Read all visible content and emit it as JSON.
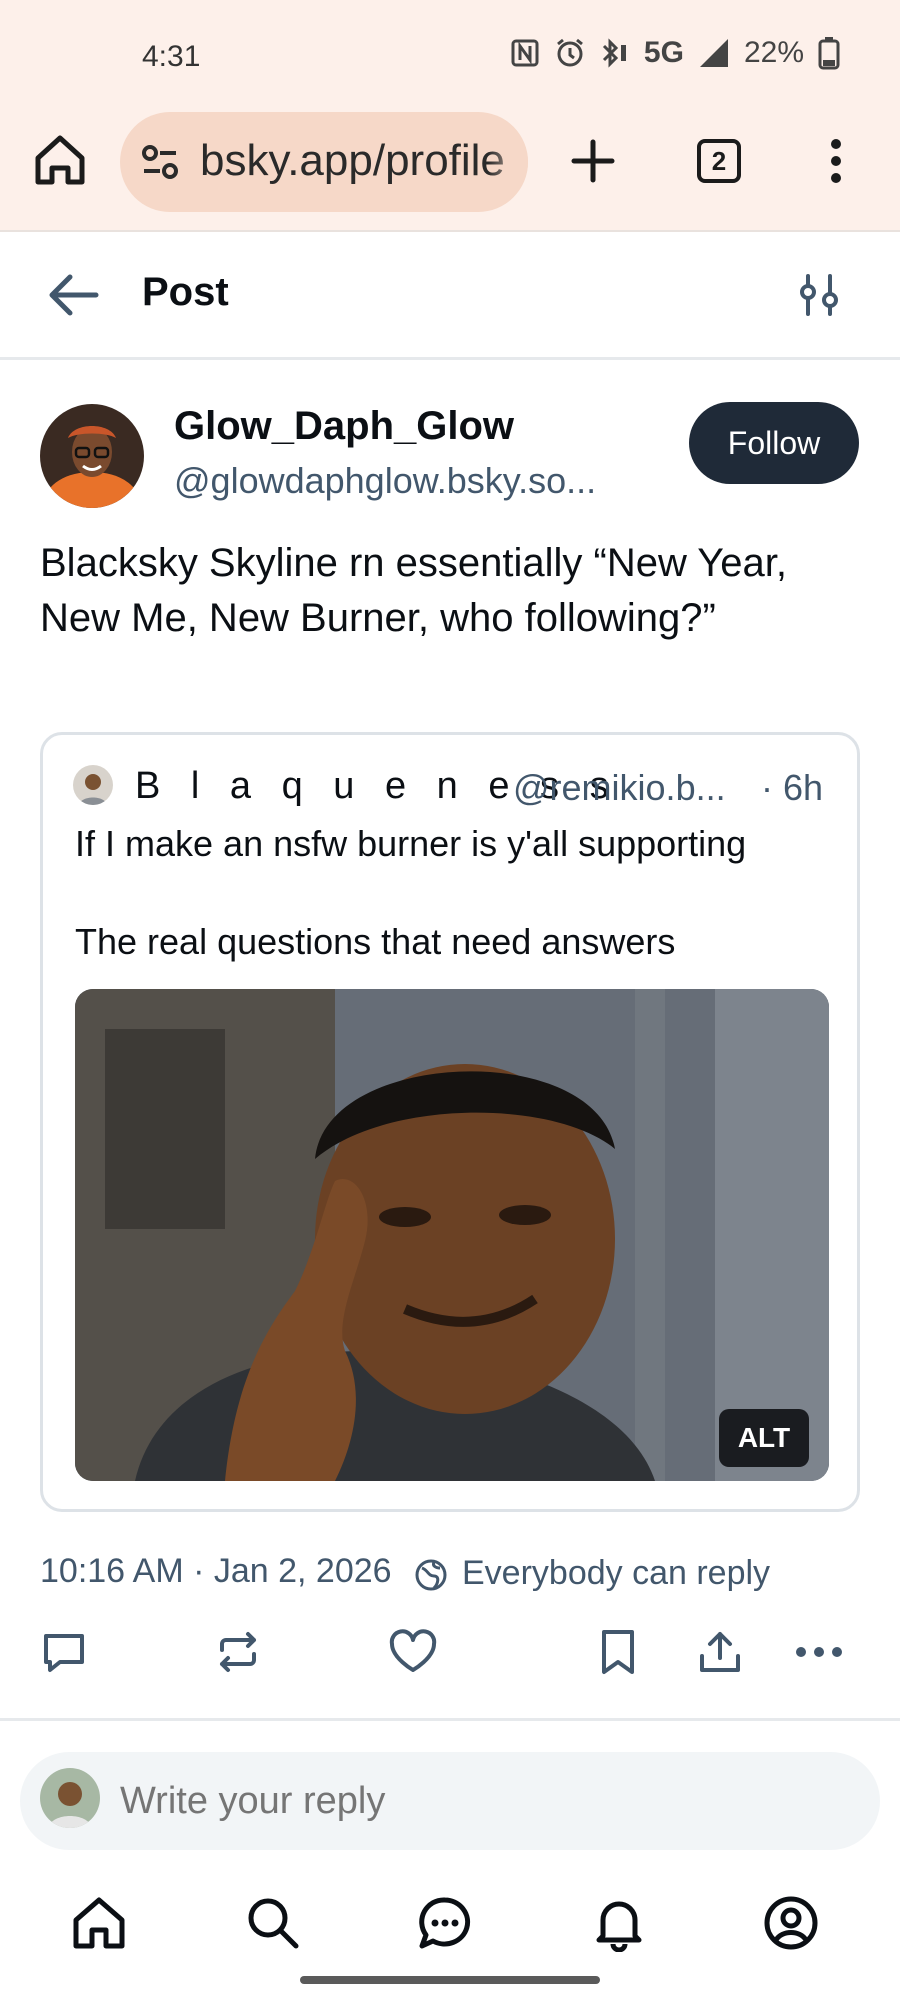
{
  "status_bar": {
    "time": "4:31",
    "network": "5G",
    "battery": "22%"
  },
  "browser": {
    "url": "bsky.app/profile",
    "tab_count": "2"
  },
  "header": {
    "title": "Post"
  },
  "post": {
    "author_name": "Glow_Daph_Glow",
    "author_handle": "@glowdaphglow.bsky.so...",
    "follow_label": "Follow",
    "text": "Blacksky Skyline rn essentially “New Year, New Me, New Burner, who following?”",
    "timestamp": "10:16 AM · Jan 2, 2026",
    "reply_setting": "Everybody can reply"
  },
  "quote": {
    "author_name": "B l a q u e n e s s",
    "author_handle": "@remikio.b...",
    "time": "· 6h",
    "line1": "If I make an nsfw burner is y'all supporting",
    "line2": "The real questions that need answers",
    "alt_label": "ALT"
  },
  "reply": {
    "placeholder": "Write your reply"
  },
  "icons": {
    "actions": [
      "reply-icon",
      "repost-icon",
      "like-icon",
      "bookmark-icon",
      "share-icon",
      "more-icon"
    ],
    "nav": [
      "home-icon",
      "search-icon",
      "chat-icon",
      "notifications-icon",
      "profile-icon"
    ]
  },
  "colors": {
    "accent_dark": "#1f2a38",
    "muted_text": "#42576c",
    "chrome_bg": "#fdf0ea",
    "url_pill": "#f6d8c8"
  }
}
